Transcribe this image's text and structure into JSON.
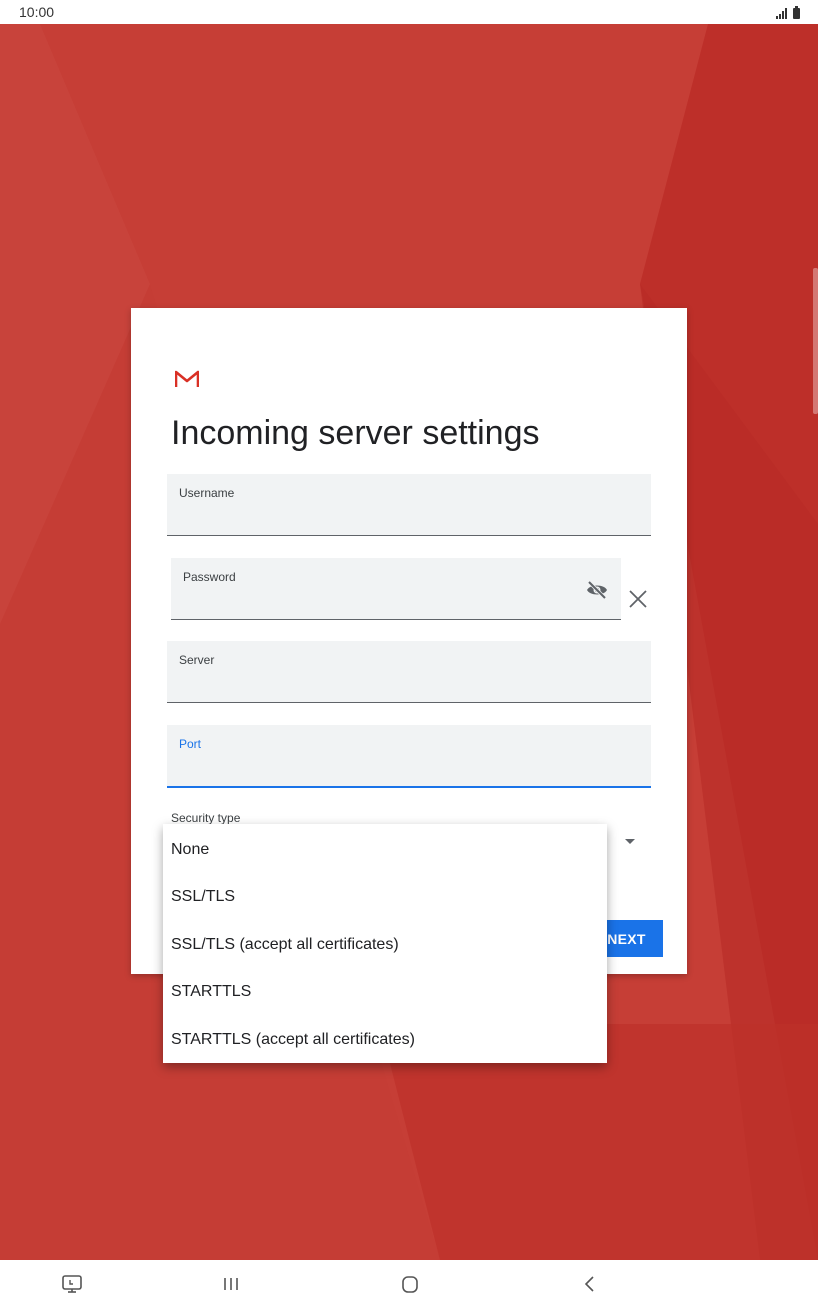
{
  "status_bar": {
    "time": "10:00",
    "signal_icon": "signal-icon",
    "battery_icon": "battery-icon"
  },
  "colors": {
    "background_red": "#c53d35",
    "accent_blue": "#1a73e8",
    "gmail_red": "#d93025"
  },
  "dialog": {
    "logo_icon": "gmail-logo-icon",
    "title": "Incoming server settings",
    "fields": {
      "username": {
        "label": "Username",
        "value": ""
      },
      "password": {
        "label": "Password",
        "value": ""
      },
      "server": {
        "label": "Server",
        "value": ""
      },
      "port": {
        "label": "Port",
        "value": ""
      }
    },
    "security_type": {
      "label": "Security type"
    },
    "next_label": "NEXT"
  },
  "security_menu": {
    "options": [
      "None",
      "SSL/TLS",
      "SSL/TLS (accept all certificates)",
      "STARTTLS",
      "STARTTLS (accept all certificates)"
    ]
  },
  "nav_bar": {
    "icons": [
      "screen-cast-icon",
      "recent-apps-icon",
      "home-icon",
      "back-icon"
    ]
  }
}
